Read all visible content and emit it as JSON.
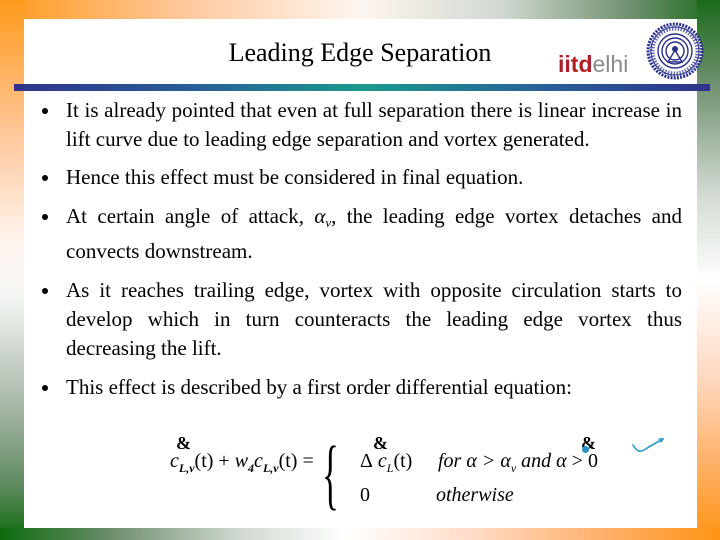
{
  "slide": {
    "title": "Leading Edge Separation",
    "logo": {
      "text_bold": "iitd",
      "text_light": "elhi",
      "emblem_icon": "iit-delhi-emblem-icon"
    },
    "colors": {
      "frame_orange": "#ff9a1c",
      "frame_green": "#1a6a1a",
      "divider_navy": "#2e3488",
      "divider_teal": "#1a9a8e",
      "logo_red": "#b11f25",
      "logo_gray": "#8a8a8a",
      "ink_blue": "#2a90c8"
    },
    "bullets": [
      {
        "text": "It is already pointed that even at full separation there is linear increase in lift curve due to leading edge separation and vortex generated."
      },
      {
        "text": "Hence this effect must be considered in final equation."
      },
      {
        "text_before": "At certain angle of attack, ",
        "symbol": "α",
        "symbol_sub": "v",
        "text_after": ", the leading edge vortex detaches and convects downstream."
      },
      {
        "text": "As it reaches trailing edge, vortex with opposite circulation starts to develop which in turn counteracts the leading edge vortex thus decreasing the lift."
      },
      {
        "text": "This effect is described by a first order differential equation:"
      }
    ],
    "equation": {
      "dot_glyph": "&",
      "lhs_c1": "c",
      "lhs_sub1": "L,v",
      "lhs_t1": "(t) + ",
      "lhs_w": "w",
      "lhs_w_sub": "4",
      "lhs_c2": "c",
      "lhs_sub2": "L,v",
      "lhs_t2": "(t) =",
      "brace": "{",
      "case1_delta": "Δ",
      "case1_c": "c",
      "case1_sub": "L",
      "case1_t": "(t)",
      "case1_condition_for": "for α > α",
      "case1_condition_sub": "v",
      "case1_condition_and": " and α",
      "case1_condition_gt": " > 0",
      "case2_value": "0",
      "case2_condition": "otherwise"
    },
    "annotation": {
      "checkmark_icon": "handwritten-checkmark-icon"
    }
  }
}
